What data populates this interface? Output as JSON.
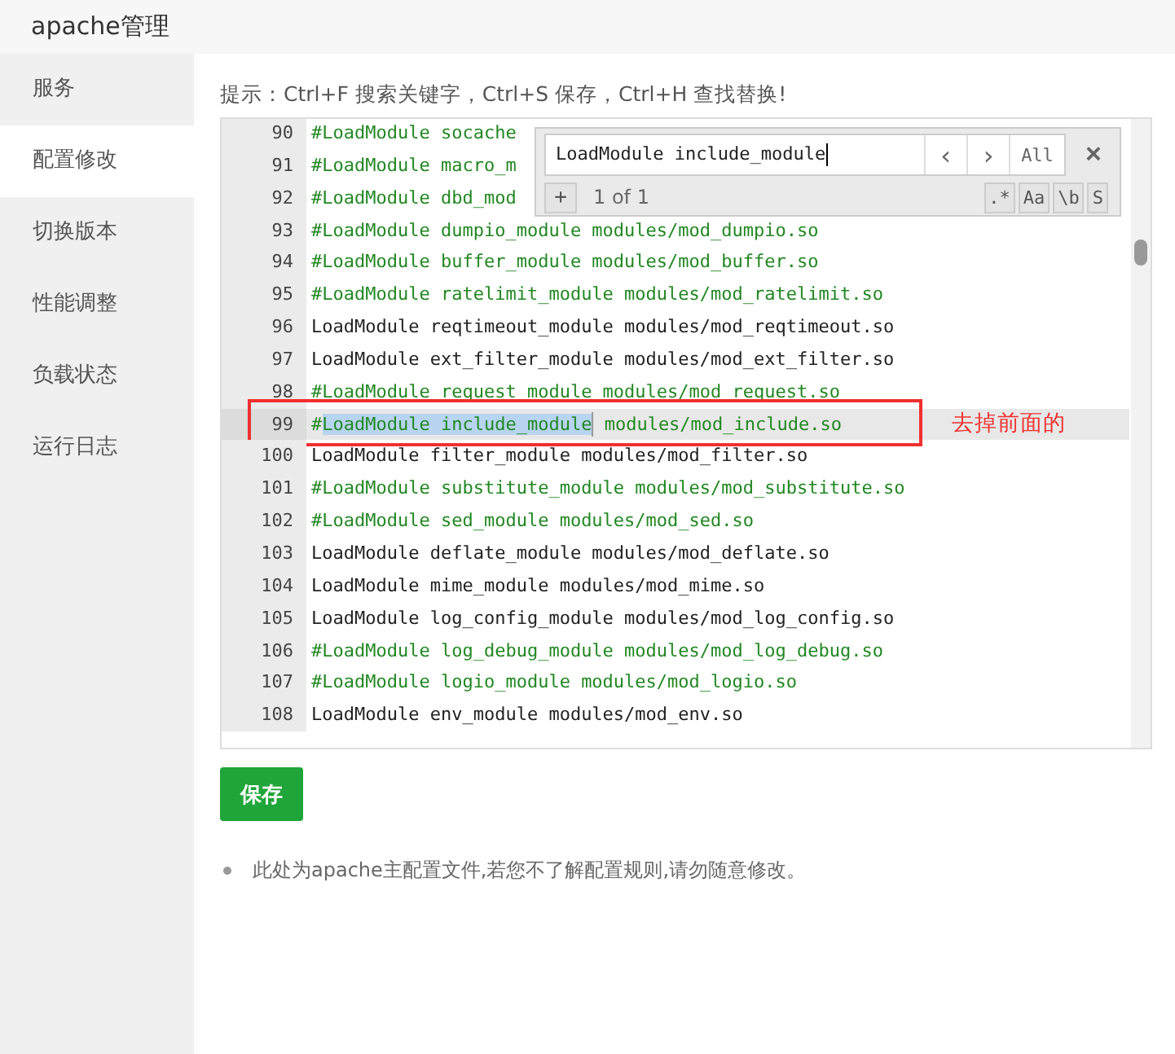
{
  "window": {
    "title": "apache管理"
  },
  "sidebar": {
    "items": [
      {
        "label": "服务",
        "selected": false
      },
      {
        "label": "配置修改",
        "selected": true
      },
      {
        "label": "切换版本",
        "selected": false
      },
      {
        "label": "性能调整",
        "selected": false
      },
      {
        "label": "负载状态",
        "selected": false
      },
      {
        "label": "运行日志",
        "selected": false
      }
    ]
  },
  "hint": "提示：Ctrl+F 搜索关键字，Ctrl+S 保存，Ctrl+H 查找替换!",
  "editor": {
    "lines": [
      {
        "number": "90",
        "text": "#LoadModule socache",
        "comment": true
      },
      {
        "number": "91",
        "text": "#LoadModule macro_m",
        "comment": true
      },
      {
        "number": "92",
        "text": "#LoadModule dbd_mod",
        "comment": true
      },
      {
        "number": "93",
        "text": "#LoadModule dumpio_module modules/mod_dumpio.so",
        "comment": true
      },
      {
        "number": "94",
        "text": "#LoadModule buffer_module modules/mod_buffer.so",
        "comment": true
      },
      {
        "number": "95",
        "text": "#LoadModule ratelimit_module modules/mod_ratelimit.so",
        "comment": true
      },
      {
        "number": "96",
        "text": "LoadModule reqtimeout_module modules/mod_reqtimeout.so",
        "comment": false
      },
      {
        "number": "97",
        "text": "LoadModule ext_filter_module modules/mod_ext_filter.so",
        "comment": false
      },
      {
        "number": "98",
        "text": "#LoadModule request_module modules/mod_request.so",
        "comment": true
      },
      {
        "number": "99",
        "prefix": "#",
        "match": "LoadModule include_module",
        "text": " modules/mod_include.so",
        "comment": true,
        "active": true
      },
      {
        "number": "100",
        "text": "LoadModule filter_module modules/mod_filter.so",
        "comment": false
      },
      {
        "number": "101",
        "text": "#LoadModule substitute_module modules/mod_substitute.so",
        "comment": true
      },
      {
        "number": "102",
        "text": "#LoadModule sed_module modules/mod_sed.so",
        "comment": true
      },
      {
        "number": "103",
        "text": "LoadModule deflate_module modules/mod_deflate.so",
        "comment": false
      },
      {
        "number": "104",
        "text": "LoadModule mime_module modules/mod_mime.so",
        "comment": false
      },
      {
        "number": "105",
        "text": "LoadModule log_config_module modules/mod_log_config.so",
        "comment": false
      },
      {
        "number": "106",
        "text": "#LoadModule log_debug_module modules/mod_log_debug.so",
        "comment": true
      },
      {
        "number": "107",
        "text": "#LoadModule logio_module modules/mod_logio.so",
        "comment": true
      },
      {
        "number": "108",
        "text": "LoadModule env_module modules/mod_env.so",
        "comment": false
      }
    ],
    "search": {
      "value": "LoadModule include_module",
      "prev": "‹",
      "next": "›",
      "all": "All",
      "close": "×",
      "add": "+",
      "count": "1 of 1",
      "options": [
        ".*",
        "Aa",
        "\\b",
        "S"
      ]
    }
  },
  "annotation": "去掉前面的",
  "save_button": "保存",
  "notes": [
    "此处为apache主配置文件,若您不了解配置规则,请勿随意修改。"
  ]
}
